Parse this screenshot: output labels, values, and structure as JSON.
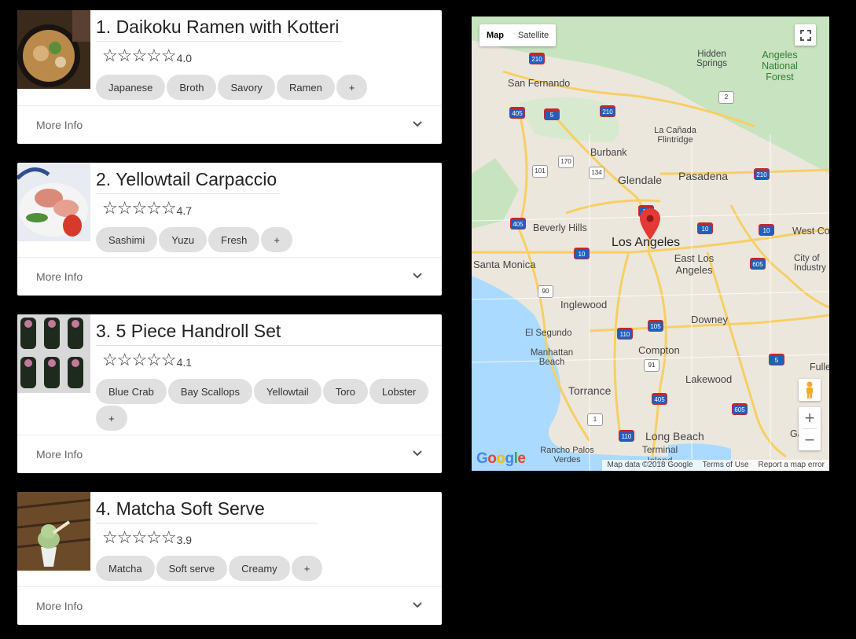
{
  "dishes": [
    {
      "title": "1. Daikoku Ramen with Kotteri",
      "stars": "☆☆☆☆☆",
      "rating": "4.0",
      "tags": [
        "Japanese",
        "Broth",
        "Savory",
        "Ramen",
        "+"
      ],
      "more": "More Info"
    },
    {
      "title": "2. Yellowtail Carpaccio",
      "stars": "☆☆☆☆☆",
      "rating": "4.7",
      "tags": [
        "Sashimi",
        "Yuzu",
        "Fresh",
        "+"
      ],
      "more": "More Info"
    },
    {
      "title": "3. 5 Piece Handroll Set",
      "stars": "☆☆☆☆☆",
      "rating": "4.1",
      "tags": [
        "Blue Crab",
        "Bay Scallops",
        "Yellowtail",
        "Toro",
        "Lobster",
        "+"
      ],
      "more": "More Info"
    },
    {
      "title": "4. Matcha Soft Serve",
      "stars": "☆☆☆☆☆",
      "rating": "3.9",
      "tags": [
        "Matcha",
        "Soft serve",
        "Creamy",
        "+"
      ],
      "more": "More Info"
    }
  ],
  "map": {
    "toggle": {
      "map": "Map",
      "satellite": "Satellite"
    },
    "zoom_in": "+",
    "zoom_out": "−",
    "places": {
      "hidden_springs": "Hidden Springs",
      "angeles_nf": "Angeles National Forest",
      "san_fernando": "San Fernando",
      "la_canada": "La Cañada Flintridge",
      "burbank": "Burbank",
      "glendale": "Glendale",
      "pasadena": "Pasadena",
      "beverly_hills": "Beverly Hills",
      "los_angeles": "Los Angeles",
      "west_covina": "West Co",
      "east_la": "East Los Angeles",
      "city_of_industry": "City of Industry",
      "santa_monica": "Santa Monica",
      "inglewood": "Inglewood",
      "downey": "Downey",
      "el_segundo": "El Segundo",
      "compton": "Compton",
      "manhattan_beach": "Manhattan Beach",
      "fullerton": "Fulle",
      "torrance": "Torrance",
      "lakewood": "Lakewood",
      "garden": "Ga",
      "long_beach": "Long Beach",
      "rancho": "Rancho Palos Verdes",
      "terminal": "Terminal Island"
    },
    "routes": [
      "210",
      "405",
      "5",
      "210",
      "2",
      "170",
      "134",
      "101",
      "210",
      "405",
      "10",
      "10",
      "10",
      "10",
      "605",
      "90",
      "105",
      "110",
      "91",
      "5",
      "405",
      "605",
      "1",
      "110"
    ],
    "google": "Google",
    "footer": {
      "data": "Map data ©2018 Google",
      "terms": "Terms of Use",
      "report": "Report a map error"
    },
    "colors": {
      "water": "#aadaff",
      "park": "#c8e6c4",
      "road": "#f6cf65",
      "marker": "#e53935"
    }
  }
}
